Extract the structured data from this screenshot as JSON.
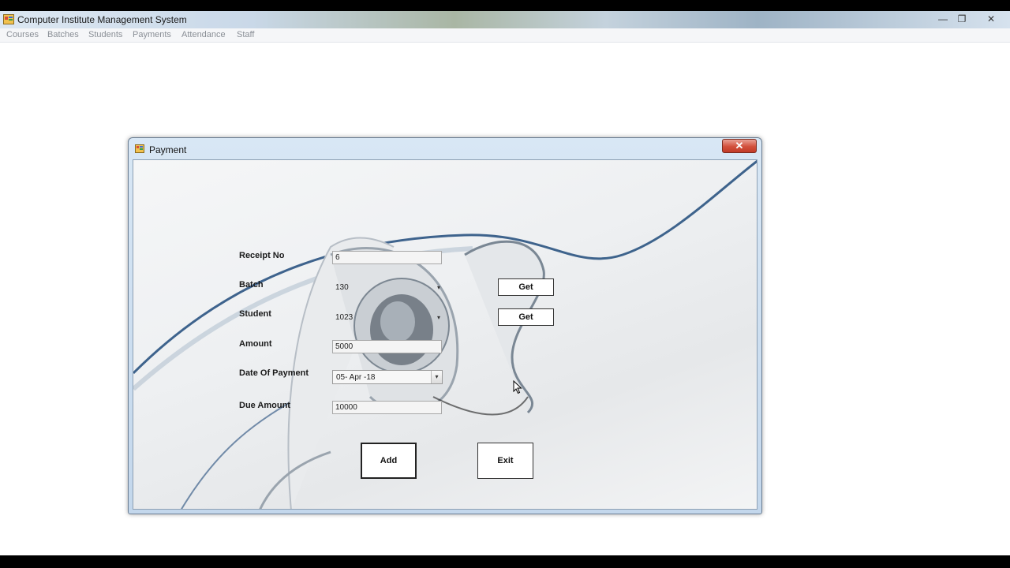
{
  "app": {
    "title": "Computer Institute Management System",
    "controls": {
      "minimize": "—",
      "restore": "❐",
      "close": "✕"
    }
  },
  "menu": [
    "Courses",
    "Batches",
    "Students",
    "Payments",
    "Attendance",
    "Staff"
  ],
  "dialog": {
    "title": "Payment",
    "close_glyph": "✕",
    "labels": {
      "receipt_no": "Receipt No",
      "batch": "Batch",
      "student": "Student",
      "amount": "Amount",
      "date_of_payment": "Date Of Payment",
      "due_amount": "Due Amount"
    },
    "values": {
      "receipt_no": "6",
      "batch": "130",
      "student": "1023",
      "amount": "5000",
      "date_of_payment": "05- Apr -18",
      "due_amount": "10000"
    },
    "buttons": {
      "get_batch": "Get",
      "get_student": "Get",
      "add": "Add",
      "exit": "Exit"
    }
  },
  "icons": {
    "app": "app-window-icon",
    "dialog": "form-icon",
    "dropdown": "chevron-down-icon"
  },
  "colors": {
    "close_button": "#c9412e",
    "titlebar": "#c9d8e8",
    "dialog_frame": "#c3d7ec",
    "swirl_accent": "#1f4a7a"
  }
}
